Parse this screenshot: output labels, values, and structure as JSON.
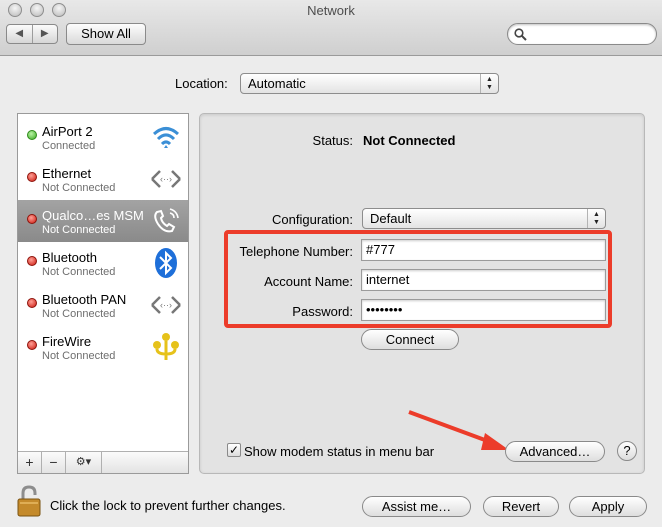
{
  "window": {
    "title": "Network"
  },
  "toolbar": {
    "back_glyph": "◀",
    "forward_glyph": "▶",
    "show_all_label": "Show All",
    "search_value": ""
  },
  "location": {
    "label": "Location:",
    "value": "Automatic"
  },
  "services": [
    {
      "name": "AirPort 2",
      "status": "Connected",
      "status_color": "green",
      "icon": "airport-wifi-icon",
      "selected": false
    },
    {
      "name": "Ethernet",
      "status": "Not Connected",
      "status_color": "red",
      "icon": "ethernet-arrows-icon",
      "selected": false
    },
    {
      "name": "Qualco…es MSM",
      "status": "Not Connected",
      "status_color": "red",
      "icon": "modem-phone-icon",
      "selected": true
    },
    {
      "name": "Bluetooth",
      "status": "Not Connected",
      "status_color": "red",
      "icon": "bluetooth-icon",
      "selected": false
    },
    {
      "name": "Bluetooth PAN",
      "status": "Not Connected",
      "status_color": "red",
      "icon": "ethernet-arrows-icon",
      "selected": false
    },
    {
      "name": "FireWire",
      "status": "Not Connected",
      "status_color": "red",
      "icon": "firewire-icon",
      "selected": false
    }
  ],
  "sidebar_toolbar": {
    "add": "+",
    "remove": "−",
    "action": "⚙▾"
  },
  "detail": {
    "status_label": "Status:",
    "status_value": "Not Connected",
    "configuration_label": "Configuration:",
    "configuration_value": "Default",
    "telephone_label": "Telephone Number:",
    "telephone_value": "#777",
    "account_label": "Account Name:",
    "account_value": "internet",
    "password_label": "Password:",
    "password_value": "••••••••",
    "connect_label": "Connect",
    "show_modem_label": "Show modem status in menu bar",
    "show_modem_checked": "✓",
    "advanced_label": "Advanced…",
    "help_label": "?"
  },
  "bottom": {
    "lock_text": "Click the lock to prevent further changes.",
    "assist_label": "Assist me…",
    "revert_label": "Revert",
    "apply_label": "Apply"
  },
  "colors": {
    "highlight_red": "#ec3c2a",
    "selection_gray": "#8a8a8a"
  }
}
